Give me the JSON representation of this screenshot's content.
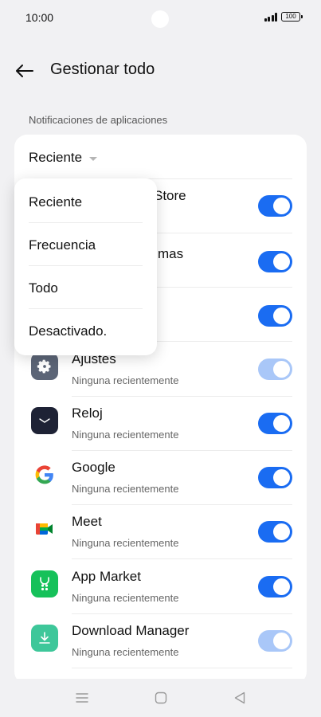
{
  "status_bar": {
    "time": "10:00",
    "battery": "100",
    "signal_icon": "signal-icon",
    "battery_icon": "battery-icon"
  },
  "header": {
    "title": "Gestionar todo",
    "back_icon": "arrow-left-icon"
  },
  "section_label": "Notificaciones de aplicaciones",
  "sort": {
    "selected": "Reciente"
  },
  "dropdown": {
    "options": [
      "Reciente",
      "Frecuencia",
      "Todo",
      "Desactivado."
    ]
  },
  "apps": [
    {
      "name": "Store",
      "subtitle": "",
      "toggle_on": true,
      "dimmed": false
    },
    {
      "name": "mas",
      "subtitle": "",
      "toggle_on": true,
      "dimmed": false
    },
    {
      "name": "",
      "subtitle": "",
      "toggle_on": true,
      "dimmed": false
    },
    {
      "name": "Ajustes",
      "subtitle": "Ninguna recientemente",
      "icon": "gear-icon",
      "toggle_on": true,
      "dimmed": true
    },
    {
      "name": "Reloj",
      "subtitle": "Ninguna recientemente",
      "icon": "clock-icon",
      "toggle_on": true,
      "dimmed": false
    },
    {
      "name": "Google",
      "subtitle": "Ninguna recientemente",
      "icon": "google-icon",
      "toggle_on": true,
      "dimmed": false
    },
    {
      "name": "Meet",
      "subtitle": "Ninguna recientemente",
      "icon": "meet-icon",
      "toggle_on": true,
      "dimmed": false
    },
    {
      "name": "App Market",
      "subtitle": "Ninguna recientemente",
      "icon": "app-market-icon",
      "toggle_on": true,
      "dimmed": false
    },
    {
      "name": "Download Manager",
      "subtitle": "Ninguna recientemente",
      "icon": "download-icon",
      "toggle_on": true,
      "dimmed": true
    }
  ],
  "colors": {
    "accent": "#1a6cf2",
    "accent_dim": "#a9c7f8",
    "background": "#f1f1f3",
    "card": "#ffffff"
  },
  "navbar": {
    "menu_icon": "menu-icon",
    "home_icon": "home-icon",
    "back_icon": "back-triangle-icon"
  }
}
